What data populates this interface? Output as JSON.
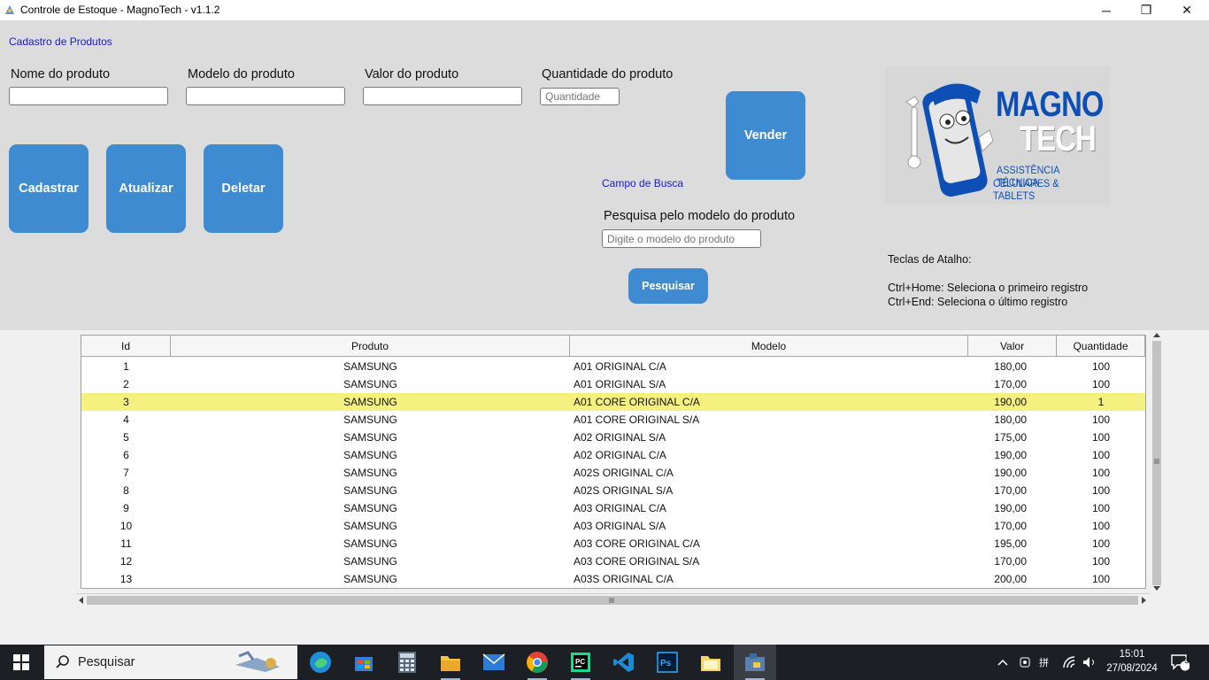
{
  "window": {
    "title": "Controle de Estoque - MagnoTech - v1.1.2",
    "min_glyph": "─",
    "max_glyph": "❐",
    "close_glyph": "✕"
  },
  "form": {
    "section_title": "Cadastro de Produtos",
    "name_label": "Nome do produto",
    "model_label": "Modelo do produto",
    "value_label": "Valor do produto",
    "qty_label": "Quantidade do produto",
    "name_value": "",
    "model_value": "",
    "value_value": "",
    "qty_placeholder": "Quantidade",
    "buttons": {
      "register": "Cadastrar",
      "update": "Atualizar",
      "delete": "Deletar",
      "sell": "Vender"
    }
  },
  "search": {
    "section_title": "Campo de Busca",
    "label": "Pesquisa pelo modelo do produto",
    "placeholder": "Digite o modelo do produto",
    "button": "Pesquisar"
  },
  "logo": {
    "line1": "MAGNO",
    "line2": "TECH",
    "line3": "ASSISTÊNCIA TÉCNICA",
    "line4": "CELULARES & TABLETS",
    "colors": {
      "primary": "#0d4fb4",
      "white": "#ffffff"
    }
  },
  "shortcuts": {
    "title": "Teclas de Atalho:",
    "first": "Ctrl+Home: Seleciona o primeiro registro",
    "last": "Ctrl+End: Seleciona o último registro"
  },
  "table": {
    "headers": [
      "Id",
      "Produto",
      "Modelo",
      "Valor",
      "Quantidade"
    ],
    "selected_row": 2,
    "rows": [
      [
        "1",
        "SAMSUNG",
        "A01 ORIGINAL C/A",
        "180,00",
        "100"
      ],
      [
        "2",
        "SAMSUNG",
        "A01 ORIGINAL S/A",
        "170,00",
        "100"
      ],
      [
        "3",
        "SAMSUNG",
        "A01 CORE ORIGINAL C/A",
        "190,00",
        "1"
      ],
      [
        "4",
        "SAMSUNG",
        "A01 CORE ORIGINAL S/A",
        "180,00",
        "100"
      ],
      [
        "5",
        "SAMSUNG",
        "A02 ORIGINAL S/A",
        "175,00",
        "100"
      ],
      [
        "6",
        "SAMSUNG",
        "A02 ORIGINAL C/A",
        "190,00",
        "100"
      ],
      [
        "7",
        "SAMSUNG",
        "A02S ORIGINAL C/A",
        "190,00",
        "100"
      ],
      [
        "8",
        "SAMSUNG",
        "A02S ORIGINAL S/A",
        "170,00",
        "100"
      ],
      [
        "9",
        "SAMSUNG",
        "A03 ORIGINAL C/A",
        "190,00",
        "100"
      ],
      [
        "10",
        "SAMSUNG",
        "A03 ORIGINAL S/A",
        "170,00",
        "100"
      ],
      [
        "11",
        "SAMSUNG",
        "A03 CORE ORIGINAL C/A",
        "195,00",
        "100"
      ],
      [
        "12",
        "SAMSUNG",
        "A03 CORE ORIGINAL S/A",
        "170,00",
        "100"
      ],
      [
        "13",
        "SAMSUNG",
        "A03S ORIGINAL C/A",
        "200,00",
        "100"
      ]
    ]
  },
  "taskbar": {
    "search_text": "Pesquisar",
    "time": "15:01",
    "date": "27/08/2024",
    "notification_count": "3",
    "apps": [
      "edge-icon",
      "store-icon",
      "calculator-icon",
      "file-explorer-icon",
      "mail-icon",
      "chrome-icon",
      "pycharm-icon",
      "vscode-icon",
      "photoshop-icon",
      "folder-icon",
      "python-icon"
    ]
  },
  "colors": {
    "panel_bg": "#dcdcdc",
    "button_blue": "#3f8bd2",
    "section_label": "#1a17d6",
    "selected_row": "#f5f181"
  }
}
